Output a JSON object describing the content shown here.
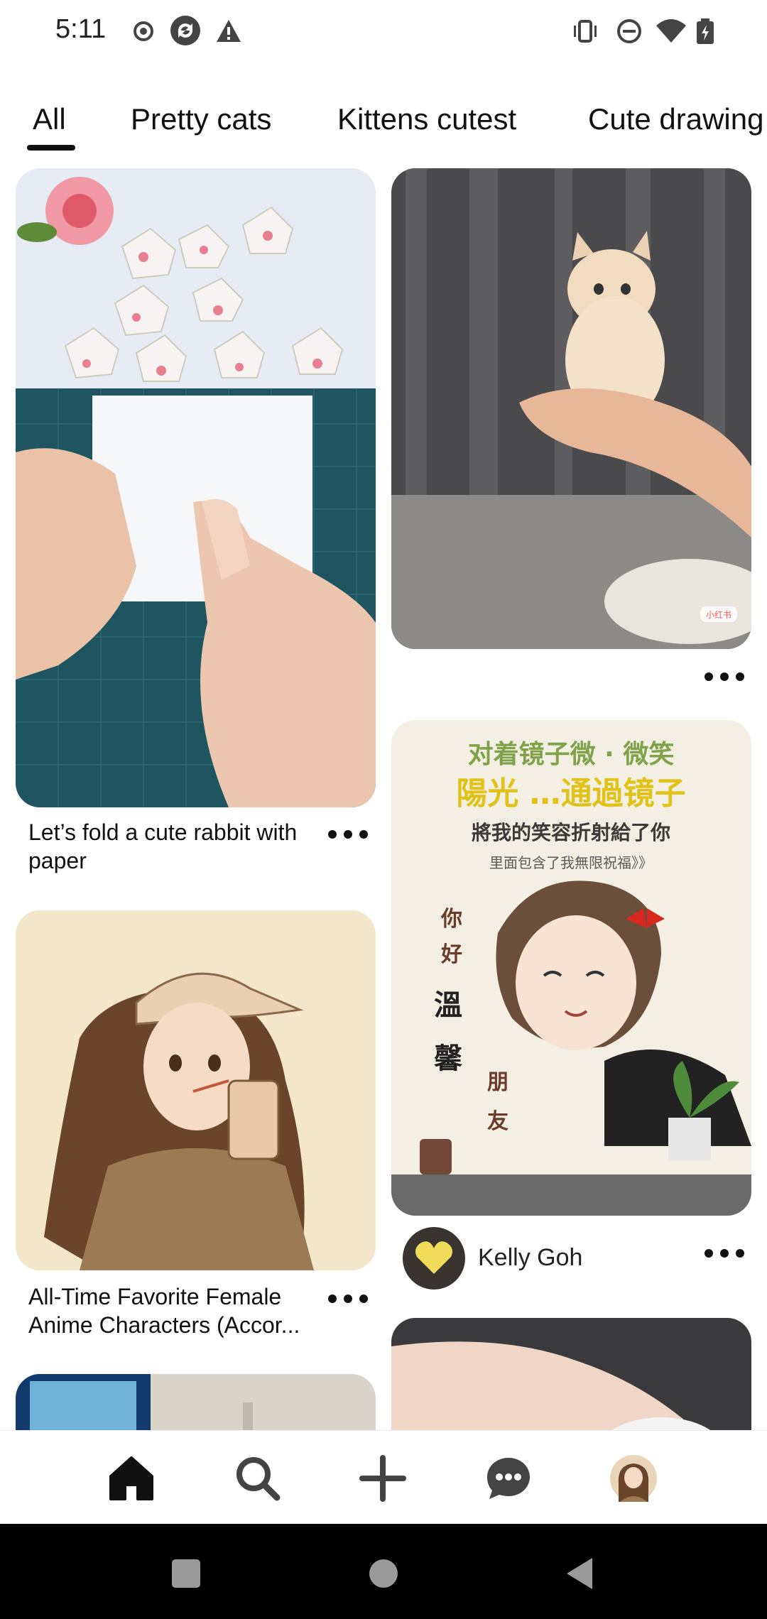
{
  "status_bar": {
    "time": "5:11",
    "left_icons": [
      "record-icon",
      "sync-icon",
      "warning-icon"
    ],
    "right_icons": [
      "vibrate-icon",
      "dnd-icon",
      "wifi-icon",
      "battery-icon"
    ]
  },
  "tabs": [
    {
      "label": "All",
      "selected": true
    },
    {
      "label": "Pretty cats",
      "selected": false
    },
    {
      "label": "Kittens cutest",
      "selected": false
    },
    {
      "label": "Cute drawing",
      "selected": false
    }
  ],
  "pins": {
    "rabbit": {
      "title": "Let’s fold a cute rabbit with paper",
      "image": "origami-rabbit-photo"
    },
    "kitten": {
      "image": "kitten-in-hands-photo",
      "watermark": "小红书"
    },
    "poster": {
      "image": "smiling-girl-poster",
      "line1": "对着镜子微 · 微笑",
      "line2": "陽光 …通過镜子",
      "line3": "將我的笑容折射給了你",
      "line4": "里面包含了我無限祝福》》",
      "side_chars": [
        "你",
        "好",
        "溫",
        "馨",
        "朋",
        "友"
      ],
      "author": "Kelly Goh"
    },
    "anime": {
      "title": "All-Time Favorite Female Anime Characters (Accor...",
      "image": "anime-girl-drinking-illustration"
    },
    "bottom_left": {
      "image": "room-photo"
    },
    "bottom_right": {
      "image": "hand-photo"
    }
  },
  "bottom_nav": [
    {
      "name": "home",
      "icon": "home-icon",
      "active": true
    },
    {
      "name": "search",
      "icon": "search-icon",
      "active": false
    },
    {
      "name": "create",
      "icon": "plus-icon",
      "active": false
    },
    {
      "name": "messages",
      "icon": "chat-icon",
      "active": false
    },
    {
      "name": "profile",
      "icon": "avatar-icon",
      "active": false
    }
  ],
  "colors": {
    "accent": "#111111",
    "poster_green": "#7fa24a",
    "poster_yellow": "#e0c21a",
    "background": "#ffffff"
  }
}
